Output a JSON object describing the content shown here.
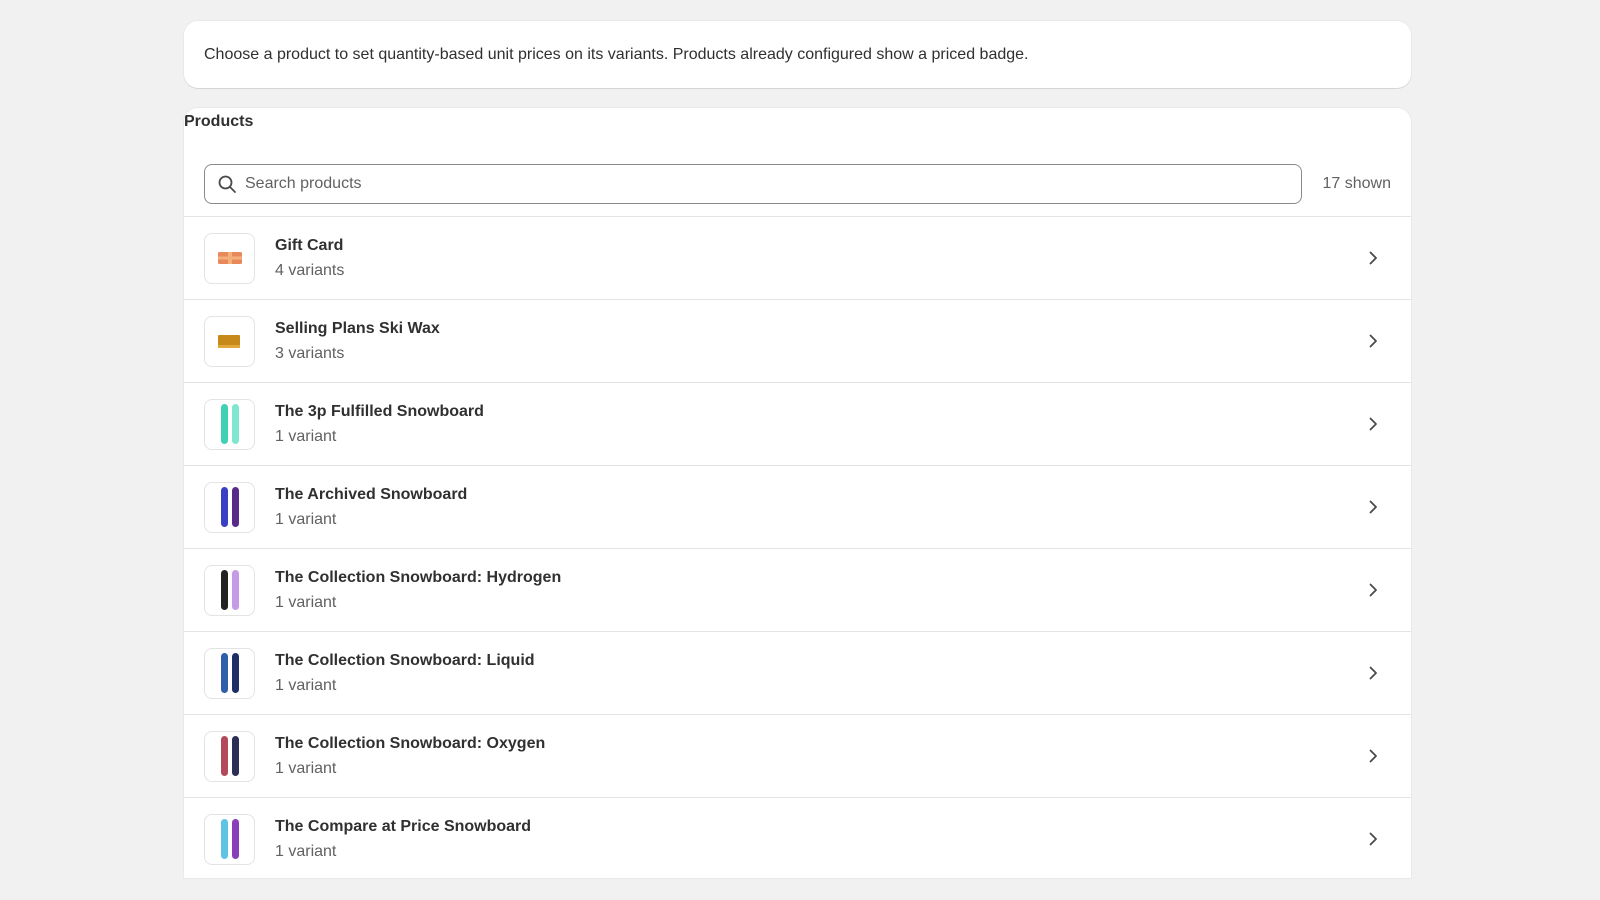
{
  "info": {
    "text": "Choose a product to set quantity-based unit prices on its variants. Products already configured show a priced badge."
  },
  "products_card": {
    "title": "Products",
    "search_placeholder": "Search products",
    "search_value": "",
    "count_label": "17 shown"
  },
  "products": [
    {
      "name": "Gift Card",
      "variants": "4 variants",
      "thumb_icon": "gift-card-icon",
      "thumb_colors": [
        "#e8895a",
        "#f3b07c"
      ]
    },
    {
      "name": "Selling Plans Ski Wax",
      "variants": "3 variants",
      "thumb_icon": "ski-wax-icon",
      "thumb_colors": [
        "#c78a1a",
        "#e0a93a"
      ]
    },
    {
      "name": "The 3p Fulfilled Snowboard",
      "variants": "1 variant",
      "thumb_icon": "snowboard-icon",
      "thumb_colors": [
        "#3fd1b3",
        "#7fe6cf"
      ]
    },
    {
      "name": "The Archived Snowboard",
      "variants": "1 variant",
      "thumb_icon": "snowboard-icon",
      "thumb_colors": [
        "#3b3fc4",
        "#5a2a8a"
      ]
    },
    {
      "name": "The Collection Snowboard: Hydrogen",
      "variants": "1 variant",
      "thumb_icon": "snowboard-icon",
      "thumb_colors": [
        "#222222",
        "#c59ae6"
      ]
    },
    {
      "name": "The Collection Snowboard: Liquid",
      "variants": "1 variant",
      "thumb_icon": "snowboard-icon",
      "thumb_colors": [
        "#2f5fa8",
        "#1f2f66"
      ]
    },
    {
      "name": "The Collection Snowboard: Oxygen",
      "variants": "1 variant",
      "thumb_icon": "snowboard-icon",
      "thumb_colors": [
        "#b34a5c",
        "#2a2f55"
      ]
    },
    {
      "name": "The Compare at Price Snowboard",
      "variants": "1 variant",
      "thumb_icon": "snowboard-icon",
      "thumb_colors": [
        "#5fc3e6",
        "#8a3fb8"
      ]
    }
  ]
}
